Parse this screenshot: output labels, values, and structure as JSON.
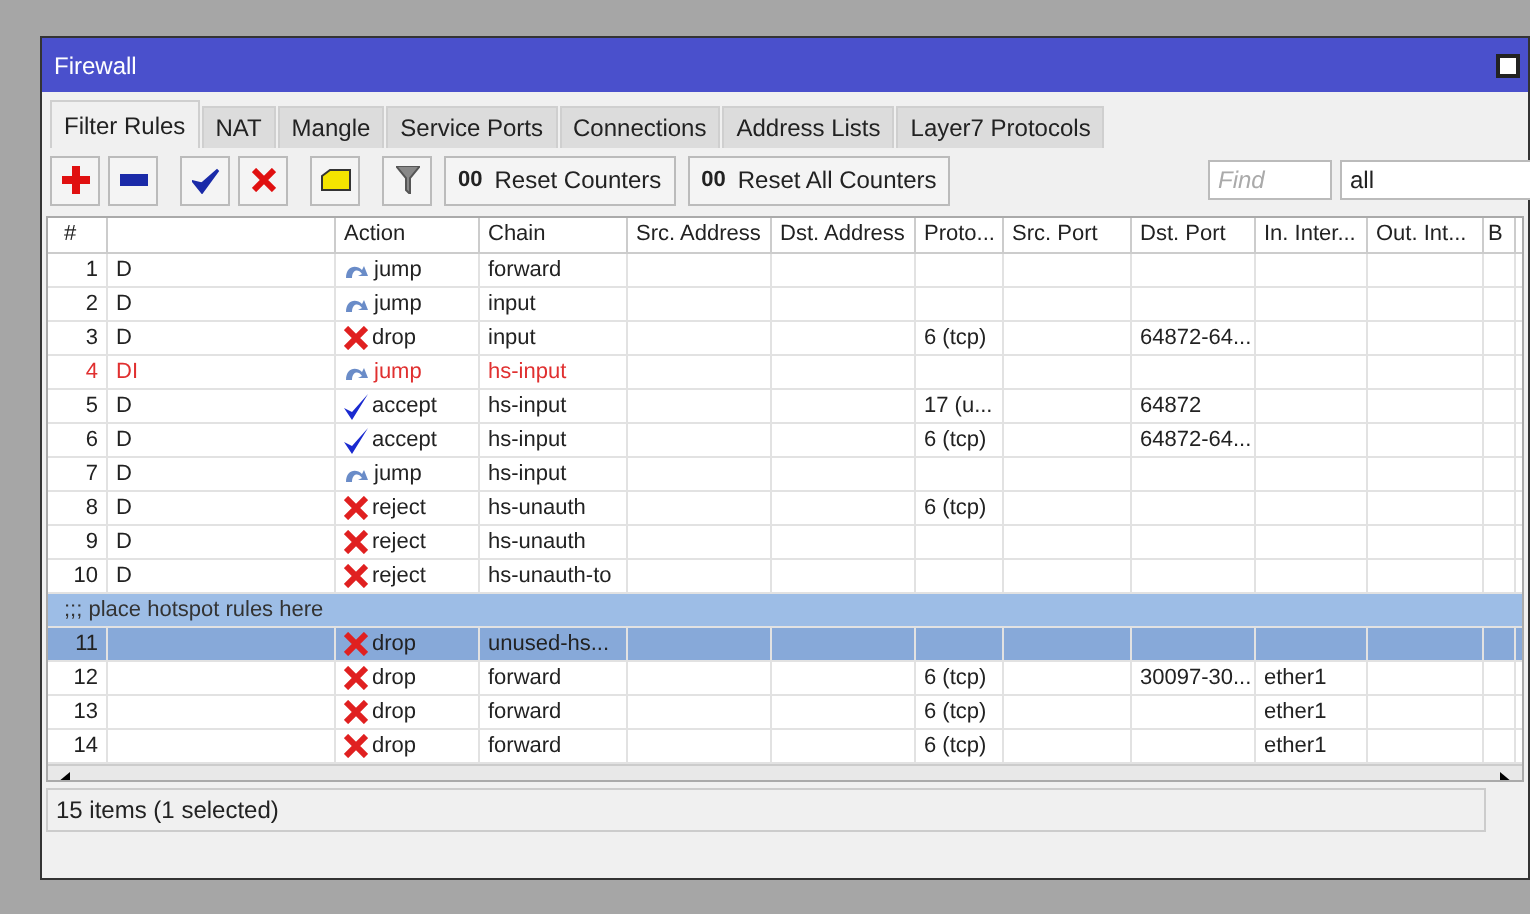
{
  "window": {
    "title": "Firewall"
  },
  "tabs": [
    {
      "label": "Filter Rules",
      "selected": true
    },
    {
      "label": "NAT",
      "selected": false
    },
    {
      "label": "Mangle",
      "selected": false
    },
    {
      "label": "Service Ports",
      "selected": false
    },
    {
      "label": "Connections",
      "selected": false
    },
    {
      "label": "Address Lists",
      "selected": false
    },
    {
      "label": "Layer7 Protocols",
      "selected": false
    }
  ],
  "toolbar": {
    "buttons": [
      {
        "kind": "add"
      },
      {
        "kind": "remove"
      },
      {
        "kind": "enable"
      },
      {
        "kind": "disable"
      },
      {
        "kind": "comment"
      },
      {
        "kind": "filter"
      },
      {
        "kind": "counter",
        "badge": "00",
        "label": "Reset Counters"
      },
      {
        "kind": "counter",
        "badge": "00",
        "label": "Reset All Counters"
      }
    ],
    "find": {
      "placeholder": "Find"
    },
    "filter_select": {
      "value": "all"
    }
  },
  "table": {
    "columns": [
      "#",
      "",
      "Action",
      "Chain",
      "Src. Address",
      "Dst. Address",
      "Proto...",
      "Src. Port",
      "Dst. Port",
      "In. Inter...",
      "Out. Int...",
      "B"
    ],
    "rows": [
      {
        "kind": "rule",
        "num": "1",
        "flags": "D",
        "action": {
          "label": "jump",
          "kind": "jump"
        },
        "chain": "forward",
        "invalid": false,
        "selected": false
      },
      {
        "kind": "rule",
        "num": "2",
        "flags": "D",
        "action": {
          "label": "jump",
          "kind": "jump"
        },
        "chain": "input",
        "invalid": false,
        "selected": false
      },
      {
        "kind": "rule",
        "num": "3",
        "flags": "D",
        "action": {
          "label": "drop",
          "kind": "drop"
        },
        "chain": "input",
        "proto": "6 (tcp)",
        "dst_port": "64872-64...",
        "invalid": false,
        "selected": false
      },
      {
        "kind": "rule",
        "num": "4",
        "flags": "DI",
        "action": {
          "label": "jump",
          "kind": "jump"
        },
        "chain": "hs-input",
        "invalid": true,
        "selected": false
      },
      {
        "kind": "rule",
        "num": "5",
        "flags": "D",
        "action": {
          "label": "accept",
          "kind": "accept"
        },
        "chain": "hs-input",
        "proto": "17 (u...",
        "dst_port": "64872",
        "invalid": false,
        "selected": false
      },
      {
        "kind": "rule",
        "num": "6",
        "flags": "D",
        "action": {
          "label": "accept",
          "kind": "accept"
        },
        "chain": "hs-input",
        "proto": "6 (tcp)",
        "dst_port": "64872-64...",
        "invalid": false,
        "selected": false
      },
      {
        "kind": "rule",
        "num": "7",
        "flags": "D",
        "action": {
          "label": "jump",
          "kind": "jump"
        },
        "chain": "hs-input",
        "invalid": false,
        "selected": false
      },
      {
        "kind": "rule",
        "num": "8",
        "flags": "D",
        "action": {
          "label": "reject",
          "kind": "drop"
        },
        "chain": "hs-unauth",
        "proto": "6 (tcp)",
        "invalid": false,
        "selected": false
      },
      {
        "kind": "rule",
        "num": "9",
        "flags": "D",
        "action": {
          "label": "reject",
          "kind": "drop"
        },
        "chain": "hs-unauth",
        "invalid": false,
        "selected": false
      },
      {
        "kind": "rule",
        "num": "10",
        "flags": "D",
        "action": {
          "label": "reject",
          "kind": "drop"
        },
        "chain": "hs-unauth-to",
        "invalid": false,
        "selected": false
      },
      {
        "kind": "comment",
        "text": ";;; place hotspot rules here",
        "selected": true
      },
      {
        "kind": "rule",
        "num": "11",
        "action": {
          "label": "drop",
          "kind": "drop"
        },
        "chain": "unused-hs...",
        "invalid": false,
        "selected": true
      },
      {
        "kind": "rule",
        "num": "12",
        "action": {
          "label": "drop",
          "kind": "drop"
        },
        "chain": "forward",
        "proto": "6 (tcp)",
        "dst_port": "30097-30...",
        "in_iface": "ether1",
        "invalid": false,
        "selected": false
      },
      {
        "kind": "rule",
        "num": "13",
        "action": {
          "label": "drop",
          "kind": "drop"
        },
        "chain": "forward",
        "proto": "6 (tcp)",
        "in_iface": "ether1",
        "invalid": false,
        "selected": false
      },
      {
        "kind": "rule",
        "num": "14",
        "action": {
          "label": "drop",
          "kind": "drop"
        },
        "chain": "forward",
        "proto": "6 (tcp)",
        "in_iface": "ether1",
        "invalid": false,
        "selected": false
      }
    ]
  },
  "status_bar": "15 items (1 selected)"
}
